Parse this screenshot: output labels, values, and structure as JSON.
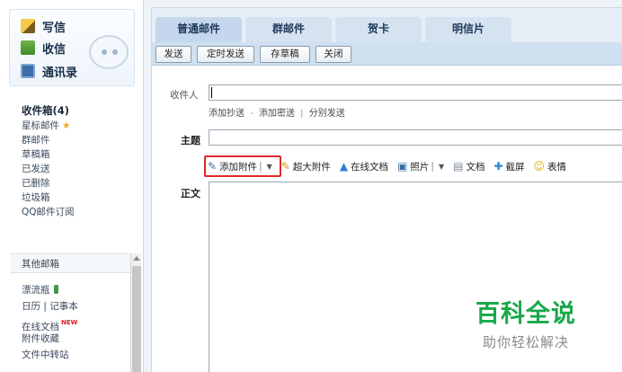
{
  "quick_actions": {
    "write": "写信",
    "receive": "收信",
    "contacts": "通讯录"
  },
  "folders": {
    "inbox": "收件箱(4)",
    "starred": "星标邮件",
    "group": "群邮件",
    "drafts": "草稿箱",
    "sent": "已发送",
    "deleted": "已删除",
    "trash": "垃圾箱",
    "subscriptions": "QQ邮件订阅"
  },
  "other_mailboxes": "其他邮箱",
  "extras": {
    "drift_bottle": "漂流瓶",
    "calendar_notes": "日历 | 记事本",
    "online_docs": "在线文档",
    "online_docs_badge": "NEW",
    "attachment_favorites": "附件收藏",
    "file_transfer": "文件中转站"
  },
  "tabs": [
    "普通邮件",
    "群邮件",
    "贺卡",
    "明信片"
  ],
  "toolbar": {
    "send": "发送",
    "schedule": "定时发送",
    "save_draft": "存草稿",
    "close": "关闭"
  },
  "compose": {
    "to_label": "收件人",
    "to_value": "",
    "cc_link": "添加抄送",
    "bcc_link": "添加密送",
    "separate_link": "分别发送",
    "link_dash": "-",
    "link_pipe": "|",
    "subject_label": "主题",
    "subject_value": "",
    "body_label": "正文"
  },
  "attachments": {
    "add_attachment": "添加附件",
    "large_attachment": "超大附件",
    "online_document": "在线文档",
    "photo": "照片",
    "document": "文档",
    "screenshot": "截屏",
    "emoji": "表情"
  },
  "watermark": {
    "title": "百科全说",
    "subtitle": "助你轻松解决"
  },
  "colors": {
    "highlight": "#e02a2a",
    "watermark_green": "#18a84a",
    "tab_bg": "#d5e3f1"
  }
}
